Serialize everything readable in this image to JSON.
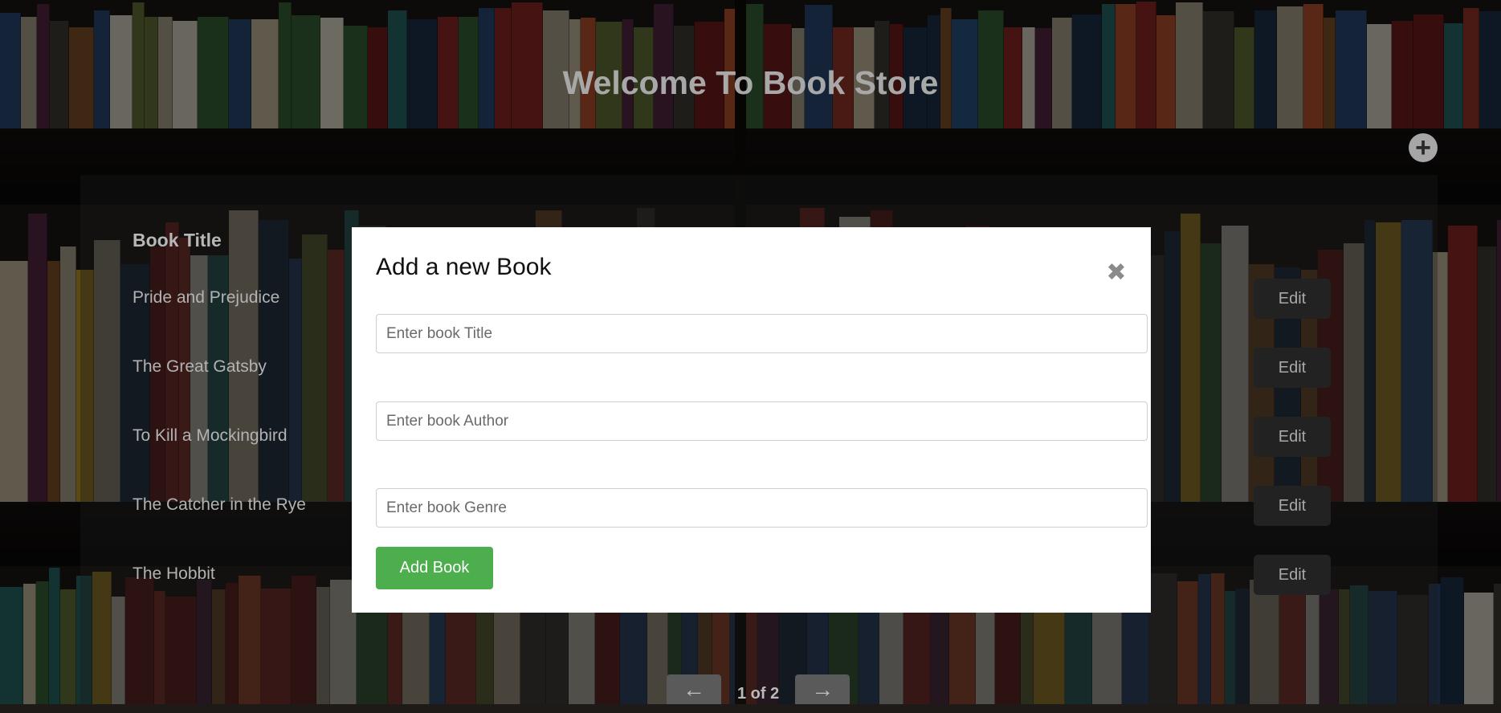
{
  "page": {
    "title": "Welcome To Book Store",
    "add_icon": "plus-circle-icon"
  },
  "table": {
    "column_title": "Book Title",
    "rows": [
      {
        "title": "Pride and Prejudice",
        "action": "Edit"
      },
      {
        "title": "The Great Gatsby",
        "action": "Edit"
      },
      {
        "title": "To Kill a Mockingbird",
        "action": "Edit"
      },
      {
        "title": "The Catcher in the Rye",
        "action": "Edit"
      },
      {
        "title": "The Hobbit",
        "action": "Edit"
      }
    ]
  },
  "pagination": {
    "prev_icon": "arrow-left-icon",
    "next_icon": "arrow-right-icon",
    "label": "1 of 2"
  },
  "modal": {
    "title": "Add a new Book",
    "close_icon": "close-icon",
    "title_placeholder": "Enter book Title",
    "author_placeholder": "Enter book Author",
    "genre_placeholder": "Enter book Genre",
    "submit_label": "Add Book"
  },
  "colors": {
    "accent_green": "#4cae4c",
    "modal_bg": "#ffffff",
    "overlay": "rgba(0,0,0,0.55)"
  }
}
